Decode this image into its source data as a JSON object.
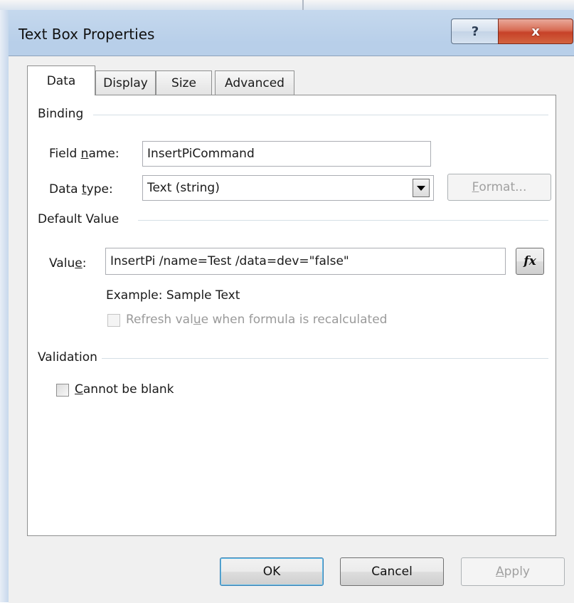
{
  "window": {
    "title": "Text Box Properties",
    "help_glyph": "?",
    "close_glyph": "x"
  },
  "tabs": [
    {
      "label": "Data",
      "active": true
    },
    {
      "label": "Display",
      "active": false
    },
    {
      "label": "Size",
      "active": false
    },
    {
      "label": "Advanced",
      "active": false
    }
  ],
  "binding": {
    "group_label": "Binding",
    "field_name_label_pre": "Field ",
    "field_name_label_u": "n",
    "field_name_label_post": "ame:",
    "field_name_value": "InsertPiCommand",
    "data_type_label_pre": "Data ",
    "data_type_label_u": "t",
    "data_type_label_post": "ype:",
    "data_type_value": "Text (string)",
    "format_label_u": "F",
    "format_label_post": "ormat..."
  },
  "default_value": {
    "group_label": "Default Value",
    "value_label_pre": "Valu",
    "value_label_u": "e",
    "value_label_post": ":",
    "value": "InsertPi /name=Test /data=dev=\"false\"",
    "fx_label": "fx",
    "example_text": "Example: Sample Text",
    "refresh_label_pre": "Refresh val",
    "refresh_label_u": "u",
    "refresh_label_post": "e when formula is recalculated"
  },
  "validation": {
    "group_label": "Validation",
    "cannot_blank_u": "C",
    "cannot_blank_post": "annot be blank"
  },
  "footer": {
    "ok_label": "OK",
    "cancel_label": "Cancel",
    "apply_label_u": "A",
    "apply_label_post": "pply"
  }
}
